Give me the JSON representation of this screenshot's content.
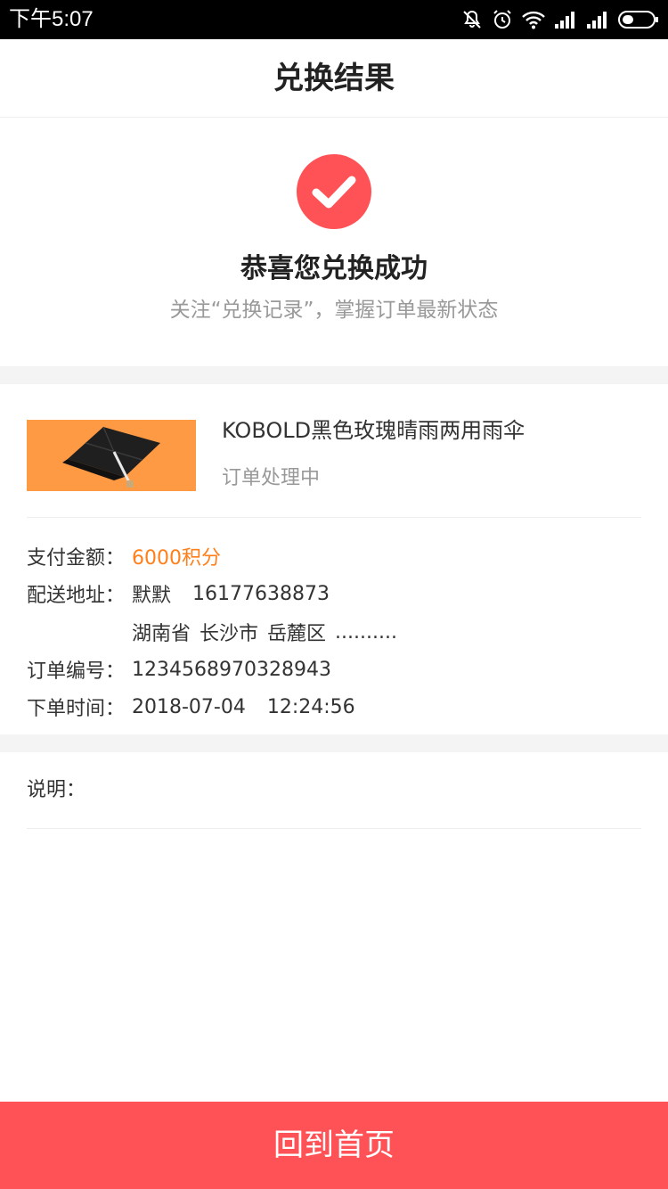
{
  "status_bar": {
    "time": "下午5:07",
    "icons": [
      "mute-icon",
      "alarm-icon",
      "wifi-icon",
      "signal-icon",
      "signal-icon",
      "battery-icon"
    ]
  },
  "header": {
    "title": "兑换结果"
  },
  "success": {
    "icon": "check-circle-icon",
    "title": "恭喜您兑换成功",
    "subtitle": "关注“兑换记录”，掌握订单最新状态"
  },
  "order": {
    "product_name": "KOBOLD黑色玫瑰晴雨两用雨伞",
    "status": "订单处理中",
    "pay_label": "支付金额：",
    "pay_value": "6000积分",
    "address_label": "配送地址：",
    "recipient_name": "默默",
    "recipient_phone": "16177638873",
    "address_province": "湖南省",
    "address_city": "长沙市",
    "address_district": "岳麓区",
    "address_more": "..........",
    "order_no_label": "订单编号：",
    "order_no": "1234568970328943",
    "time_label": "下单时间：",
    "order_date": "2018-07-04",
    "order_time": "12:24:56"
  },
  "notes": {
    "label": "说明："
  },
  "footer": {
    "home_button_label": "回到首页"
  },
  "colors": {
    "accent_red": "#ff5257",
    "points_orange": "#ff7f1a",
    "thumb_bg": "#ff9a44"
  }
}
